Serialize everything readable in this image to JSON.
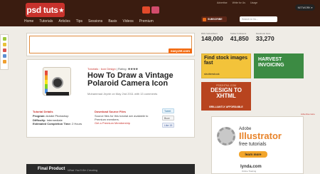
{
  "header": {
    "logo": "psd tuts",
    "logo_star": "★",
    "top_links": [
      "Advertise",
      "Write for Us",
      "Usage"
    ],
    "network_label": "NETWORK",
    "subscribe_label": "SUBSCRIBE",
    "search_placeholder": "Search & Go..."
  },
  "nav": {
    "items": [
      "Home",
      "Tutorials",
      "Articles",
      "Tips",
      "Sessions",
      "Basix",
      "Videos",
      "Premium"
    ]
  },
  "ad_banner": {
    "brand": "easyJet.com"
  },
  "stats": [
    {
      "label": "RSS Subscribers",
      "value": "148,000"
    },
    {
      "label": "Twitter Followers",
      "value": "41,850"
    },
    {
      "label": "Facebook Fans",
      "value": "33,270"
    }
  ],
  "article": {
    "category_links": [
      "Tutorials",
      "Icon Design"
    ],
    "rating_label": "Rating:",
    "rating_stars": "★★★★",
    "title": "How To Draw a Vintage Polaroid Camera Icon",
    "byline": "Mohammad Jeprie on May 2nd 2011 with 13 comments",
    "details_heading": "Tutorial Details",
    "program_label": "Program:",
    "program_value": "Adobe Photoshop",
    "difficulty_label": "Difficulty:",
    "difficulty_value": "Intermediate",
    "time_label": "Estimated Completion Time:",
    "time_value": "2 Hours",
    "download_heading": "Download Source Files",
    "download_text": "Source files for this tutorial are available to Premium members.",
    "download_link": "Get a Premium Membership",
    "share_tweet": "Tweet",
    "share_buzz": "Buzz",
    "share_like": "Like",
    "share_count": "15"
  },
  "final_product": {
    "title": "Final Product",
    "subtitle": "What You'll Be Creating"
  },
  "side_ads": {
    "stock_title": "Find stock images fast",
    "stock_brand": "shutterstock",
    "harvest_title": "HARVEST INVOICING",
    "xhtml_small": "PSD2HTML.COM",
    "xhtml_title": "DESIGN TO XHTML",
    "xhtml_tag": "BRILLIANTLY AFFORDABLE",
    "advertise_here": "Advertise Here",
    "illustrator_top": "Adobe",
    "illustrator_title": "Illustrator",
    "illustrator_sub": "free tutorials",
    "illustrator_btn": "learn more",
    "lynda": "lynda.com",
    "lynda_sub": "Online Training"
  },
  "colors": {
    "header_bg": "#3a1c10",
    "brand_red": "#c8322c",
    "page_bg": "#efece6"
  }
}
